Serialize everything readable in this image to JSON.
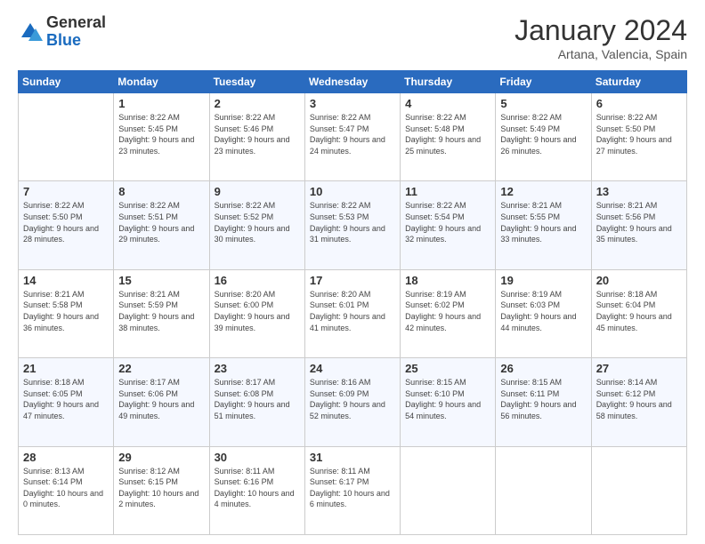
{
  "header": {
    "logo_general": "General",
    "logo_blue": "Blue",
    "title": "January 2024",
    "location": "Artana, Valencia, Spain"
  },
  "weekdays": [
    "Sunday",
    "Monday",
    "Tuesday",
    "Wednesday",
    "Thursday",
    "Friday",
    "Saturday"
  ],
  "weeks": [
    [
      {
        "day": "",
        "sunrise": "",
        "sunset": "",
        "daylight": ""
      },
      {
        "day": "1",
        "sunrise": "Sunrise: 8:22 AM",
        "sunset": "Sunset: 5:45 PM",
        "daylight": "Daylight: 9 hours and 23 minutes."
      },
      {
        "day": "2",
        "sunrise": "Sunrise: 8:22 AM",
        "sunset": "Sunset: 5:46 PM",
        "daylight": "Daylight: 9 hours and 23 minutes."
      },
      {
        "day": "3",
        "sunrise": "Sunrise: 8:22 AM",
        "sunset": "Sunset: 5:47 PM",
        "daylight": "Daylight: 9 hours and 24 minutes."
      },
      {
        "day": "4",
        "sunrise": "Sunrise: 8:22 AM",
        "sunset": "Sunset: 5:48 PM",
        "daylight": "Daylight: 9 hours and 25 minutes."
      },
      {
        "day": "5",
        "sunrise": "Sunrise: 8:22 AM",
        "sunset": "Sunset: 5:49 PM",
        "daylight": "Daylight: 9 hours and 26 minutes."
      },
      {
        "day": "6",
        "sunrise": "Sunrise: 8:22 AM",
        "sunset": "Sunset: 5:50 PM",
        "daylight": "Daylight: 9 hours and 27 minutes."
      }
    ],
    [
      {
        "day": "7",
        "sunrise": "Sunrise: 8:22 AM",
        "sunset": "Sunset: 5:50 PM",
        "daylight": "Daylight: 9 hours and 28 minutes."
      },
      {
        "day": "8",
        "sunrise": "Sunrise: 8:22 AM",
        "sunset": "Sunset: 5:51 PM",
        "daylight": "Daylight: 9 hours and 29 minutes."
      },
      {
        "day": "9",
        "sunrise": "Sunrise: 8:22 AM",
        "sunset": "Sunset: 5:52 PM",
        "daylight": "Daylight: 9 hours and 30 minutes."
      },
      {
        "day": "10",
        "sunrise": "Sunrise: 8:22 AM",
        "sunset": "Sunset: 5:53 PM",
        "daylight": "Daylight: 9 hours and 31 minutes."
      },
      {
        "day": "11",
        "sunrise": "Sunrise: 8:22 AM",
        "sunset": "Sunset: 5:54 PM",
        "daylight": "Daylight: 9 hours and 32 minutes."
      },
      {
        "day": "12",
        "sunrise": "Sunrise: 8:21 AM",
        "sunset": "Sunset: 5:55 PM",
        "daylight": "Daylight: 9 hours and 33 minutes."
      },
      {
        "day": "13",
        "sunrise": "Sunrise: 8:21 AM",
        "sunset": "Sunset: 5:56 PM",
        "daylight": "Daylight: 9 hours and 35 minutes."
      }
    ],
    [
      {
        "day": "14",
        "sunrise": "Sunrise: 8:21 AM",
        "sunset": "Sunset: 5:58 PM",
        "daylight": "Daylight: 9 hours and 36 minutes."
      },
      {
        "day": "15",
        "sunrise": "Sunrise: 8:21 AM",
        "sunset": "Sunset: 5:59 PM",
        "daylight": "Daylight: 9 hours and 38 minutes."
      },
      {
        "day": "16",
        "sunrise": "Sunrise: 8:20 AM",
        "sunset": "Sunset: 6:00 PM",
        "daylight": "Daylight: 9 hours and 39 minutes."
      },
      {
        "day": "17",
        "sunrise": "Sunrise: 8:20 AM",
        "sunset": "Sunset: 6:01 PM",
        "daylight": "Daylight: 9 hours and 41 minutes."
      },
      {
        "day": "18",
        "sunrise": "Sunrise: 8:19 AM",
        "sunset": "Sunset: 6:02 PM",
        "daylight": "Daylight: 9 hours and 42 minutes."
      },
      {
        "day": "19",
        "sunrise": "Sunrise: 8:19 AM",
        "sunset": "Sunset: 6:03 PM",
        "daylight": "Daylight: 9 hours and 44 minutes."
      },
      {
        "day": "20",
        "sunrise": "Sunrise: 8:18 AM",
        "sunset": "Sunset: 6:04 PM",
        "daylight": "Daylight: 9 hours and 45 minutes."
      }
    ],
    [
      {
        "day": "21",
        "sunrise": "Sunrise: 8:18 AM",
        "sunset": "Sunset: 6:05 PM",
        "daylight": "Daylight: 9 hours and 47 minutes."
      },
      {
        "day": "22",
        "sunrise": "Sunrise: 8:17 AM",
        "sunset": "Sunset: 6:06 PM",
        "daylight": "Daylight: 9 hours and 49 minutes."
      },
      {
        "day": "23",
        "sunrise": "Sunrise: 8:17 AM",
        "sunset": "Sunset: 6:08 PM",
        "daylight": "Daylight: 9 hours and 51 minutes."
      },
      {
        "day": "24",
        "sunrise": "Sunrise: 8:16 AM",
        "sunset": "Sunset: 6:09 PM",
        "daylight": "Daylight: 9 hours and 52 minutes."
      },
      {
        "day": "25",
        "sunrise": "Sunrise: 8:15 AM",
        "sunset": "Sunset: 6:10 PM",
        "daylight": "Daylight: 9 hours and 54 minutes."
      },
      {
        "day": "26",
        "sunrise": "Sunrise: 8:15 AM",
        "sunset": "Sunset: 6:11 PM",
        "daylight": "Daylight: 9 hours and 56 minutes."
      },
      {
        "day": "27",
        "sunrise": "Sunrise: 8:14 AM",
        "sunset": "Sunset: 6:12 PM",
        "daylight": "Daylight: 9 hours and 58 minutes."
      }
    ],
    [
      {
        "day": "28",
        "sunrise": "Sunrise: 8:13 AM",
        "sunset": "Sunset: 6:14 PM",
        "daylight": "Daylight: 10 hours and 0 minutes."
      },
      {
        "day": "29",
        "sunrise": "Sunrise: 8:12 AM",
        "sunset": "Sunset: 6:15 PM",
        "daylight": "Daylight: 10 hours and 2 minutes."
      },
      {
        "day": "30",
        "sunrise": "Sunrise: 8:11 AM",
        "sunset": "Sunset: 6:16 PM",
        "daylight": "Daylight: 10 hours and 4 minutes."
      },
      {
        "day": "31",
        "sunrise": "Sunrise: 8:11 AM",
        "sunset": "Sunset: 6:17 PM",
        "daylight": "Daylight: 10 hours and 6 minutes."
      },
      {
        "day": "",
        "sunrise": "",
        "sunset": "",
        "daylight": ""
      },
      {
        "day": "",
        "sunrise": "",
        "sunset": "",
        "daylight": ""
      },
      {
        "day": "",
        "sunrise": "",
        "sunset": "",
        "daylight": ""
      }
    ]
  ]
}
